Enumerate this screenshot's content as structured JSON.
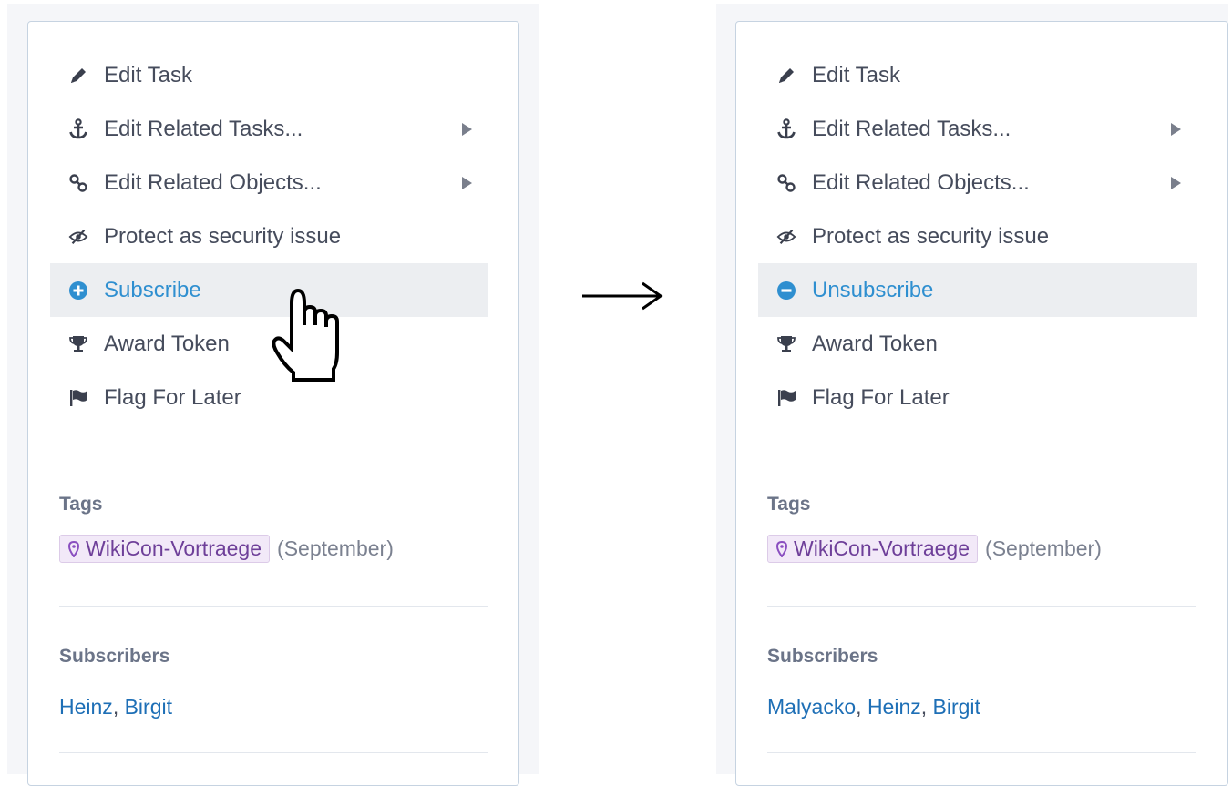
{
  "panels": {
    "before": {
      "menu": [
        {
          "label": "Edit Task",
          "icon": "pencil-icon",
          "submenu": false
        },
        {
          "label": "Edit Related Tasks...",
          "icon": "anchor-icon",
          "submenu": true
        },
        {
          "label": "Edit Related Objects...",
          "icon": "link-icon",
          "submenu": true
        },
        {
          "label": "Protect as security issue",
          "icon": "eye-slash-icon",
          "submenu": false
        },
        {
          "label": "Subscribe",
          "icon": "plus-circle-icon",
          "submenu": false,
          "highlighted": true
        },
        {
          "label": "Award Token",
          "icon": "trophy-icon",
          "submenu": false
        },
        {
          "label": "Flag For Later",
          "icon": "flag-icon",
          "submenu": false
        }
      ],
      "tags_title": "Tags",
      "tag": {
        "name": "WikiCon-Vortraege",
        "suffix": "(September)",
        "icon": "map-pin-icon"
      },
      "subscribers_title": "Subscribers",
      "subscribers": [
        "Heinz",
        "Birgit"
      ]
    },
    "after": {
      "menu": [
        {
          "label": "Edit Task",
          "icon": "pencil-icon",
          "submenu": false
        },
        {
          "label": "Edit Related Tasks...",
          "icon": "anchor-icon",
          "submenu": true
        },
        {
          "label": "Edit Related Objects...",
          "icon": "link-icon",
          "submenu": true
        },
        {
          "label": "Protect as security issue",
          "icon": "eye-slash-icon",
          "submenu": false
        },
        {
          "label": "Unsubscribe",
          "icon": "minus-circle-icon",
          "submenu": false,
          "highlighted": true
        },
        {
          "label": "Award Token",
          "icon": "trophy-icon",
          "submenu": false
        },
        {
          "label": "Flag For Later",
          "icon": "flag-icon",
          "submenu": false
        }
      ],
      "tags_title": "Tags",
      "tag": {
        "name": "WikiCon-Vortraege",
        "suffix": "(September)",
        "icon": "map-pin-icon"
      },
      "subscribers_title": "Subscribers",
      "subscribers": [
        "Malyacko",
        "Heinz",
        "Birgit"
      ]
    }
  },
  "subscribers_separator": ", ",
  "transition_arrow": "right-arrow-icon",
  "cursor": "pointing-hand-cursor-icon",
  "colors": {
    "highlight_text": "#2f8fd0",
    "highlight_bg": "#eceef1",
    "link": "#1e6fb6",
    "tag_bg": "#f2e9f8",
    "tag_text": "#6e3f99"
  }
}
